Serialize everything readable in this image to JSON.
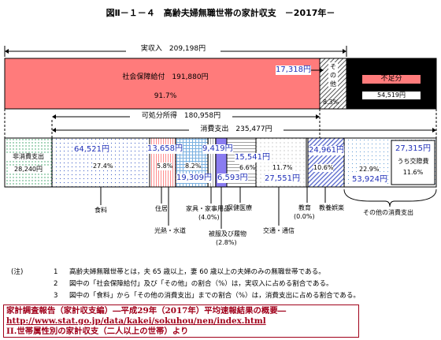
{
  "title": "図Ⅱ－１－４　高齢夫婦無職世帯の家計収支　－2017年－",
  "income": {
    "total_label": "実収入　209,198円",
    "social_security_label": "社会保障給付　191,880円",
    "social_security_pct": "91.7%",
    "other_value": "17,318円",
    "other_label": "その他",
    "other_pct": "8.3%",
    "shortfall_label": "不足分",
    "shortfall_value": "54,519円"
  },
  "disposable": {
    "label": "可処分所得　180,958円"
  },
  "consumption": {
    "label": "消費支出　235,477円"
  },
  "non_consumption": {
    "label": "非消費支出",
    "value": "28,240円"
  },
  "segments": {
    "food": {
      "value": "64,521円",
      "pct": "27.4%",
      "label": "食料"
    },
    "housing": {
      "value": "13,658円",
      "pct": "5.8%",
      "label": "住居"
    },
    "utilities": {
      "value": "19,309円",
      "pct": "8.2%",
      "label": "光熱・水道"
    },
    "furniture": {
      "value": "9,419円",
      "pct": "(4.0%)",
      "label": "家具・家事用品"
    },
    "clothing": {
      "value": "6,593円",
      "pct": "(2.8%)",
      "label": "被服及び履物"
    },
    "medical": {
      "value": "15,541円",
      "pct": "6.6%",
      "label": "保健医療"
    },
    "transport": {
      "value": "27,551円",
      "pct": "11.7%",
      "label": "交通・通信"
    },
    "education": {
      "value": "",
      "pct": "(0.0%)",
      "label": "教育"
    },
    "recreation": {
      "value": "24,961円",
      "pct": "10.6%",
      "label": "教養娯楽"
    },
    "other_consumption": {
      "value": "53,924円",
      "pct": "22.9%",
      "label": "その他の消費支出"
    },
    "social_expense": {
      "value": "27,315円",
      "label": "うち交際費",
      "pct": "11.6%"
    }
  },
  "notes": {
    "prefix": "(注)",
    "n1_num": "1",
    "n1": "高齢夫婦無職世帯とは，夫 65 歳以上，妻 60 歳以上の夫婦のみの無職世帯である。",
    "n2_num": "2",
    "n2": "図中の「社会保障給付」及び「その他」の割合（%）は，実収入に占める割合である。",
    "n3_num": "3",
    "n3": "図中の「食料」から「その他の消費支出」までの割合（%）は，消費支出に占める割合である。"
  },
  "source": {
    "line1": "家計調査報告（家計収支編）―平成29年（2017年）平均速報結果の概要―",
    "line2": "http://www.stat.go.jp/data/kakei/sokuhou/nen/index.html",
    "line3": "II.世帯属性別の家計収支（二人以上の世帯）より"
  },
  "colors": {
    "social_security": "#ff7b7b",
    "shortfall": "#000000",
    "clothing": "#8a7cf0",
    "value_text": "#1f2fb8",
    "source_text": "#a0001a"
  }
}
